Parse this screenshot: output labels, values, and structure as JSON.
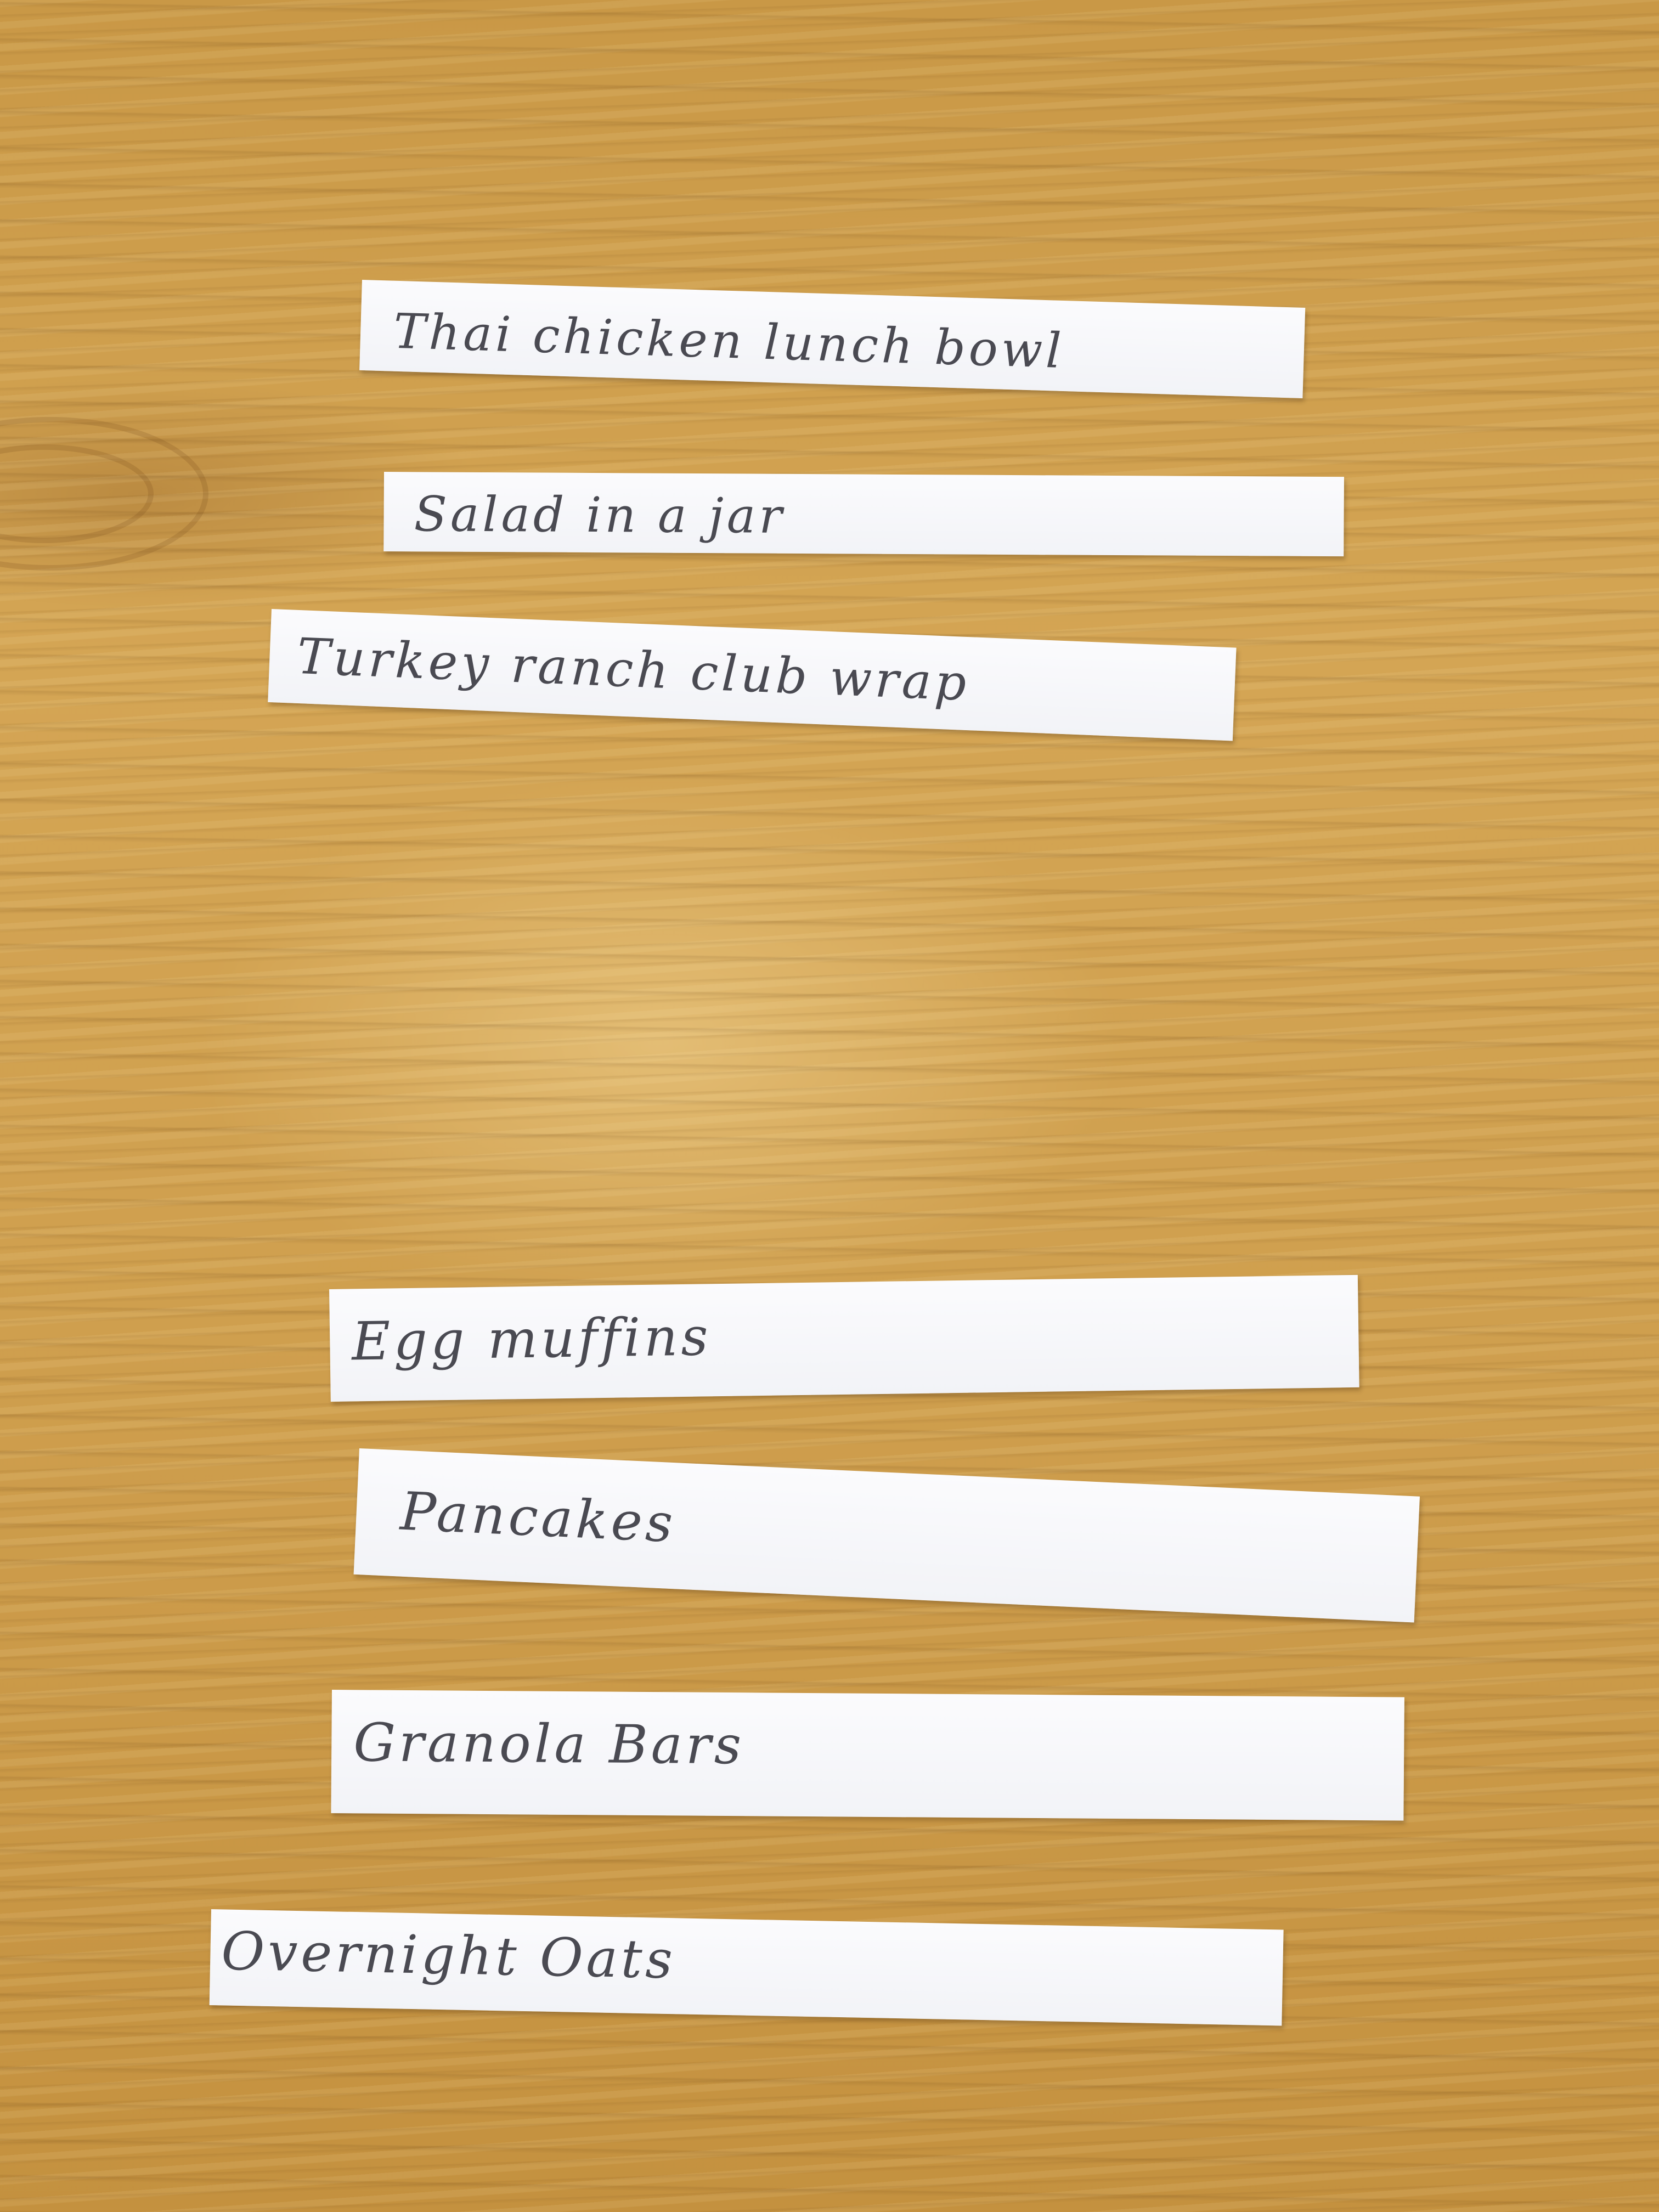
{
  "strips": [
    {
      "text": "Thai chicken lunch bowl"
    },
    {
      "text": "Salad in a jar"
    },
    {
      "text": "Turkey ranch club wrap"
    },
    {
      "text": "Egg muffins"
    },
    {
      "text": "Pancakes"
    },
    {
      "text": "Granola Bars"
    },
    {
      "text": "Overnight Oats"
    }
  ],
  "colors": {
    "table_wood": "#cf9f4e",
    "paper": "#f5f6f9",
    "pencil": "#4a4a52"
  }
}
